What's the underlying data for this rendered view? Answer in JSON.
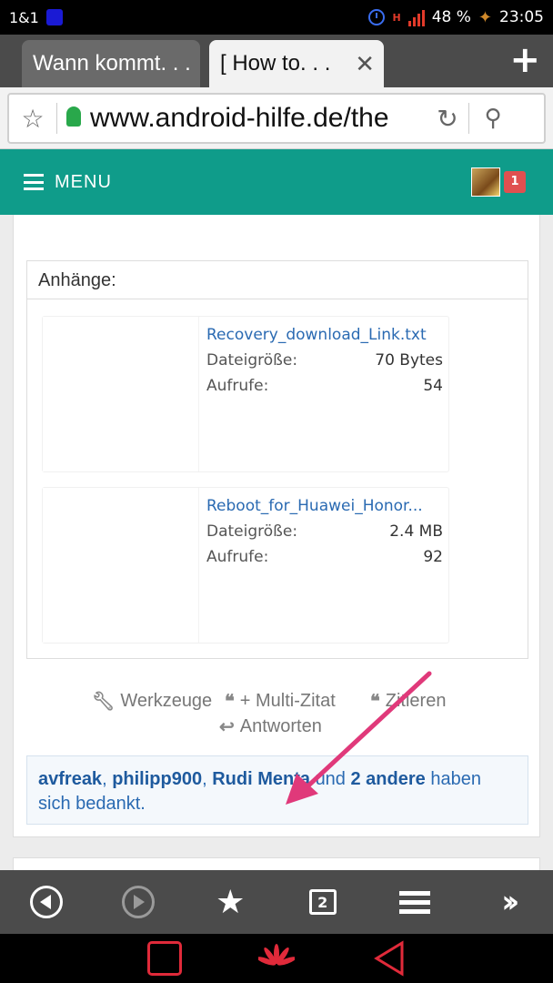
{
  "status_bar": {
    "carrier": "1&1",
    "battery": "48 %",
    "time": "23:05",
    "network_label": "H"
  },
  "tabs": [
    {
      "label": "Wann kommt. . ."
    },
    {
      "label": "[ How to. . ."
    }
  ],
  "address_bar": {
    "url": "www.android-hilfe.de/the"
  },
  "site_header": {
    "menu_label": "MENU",
    "notification_count": "1"
  },
  "attachments": {
    "title": "Anhänge:",
    "items": [
      {
        "name": "Recovery_download_Link.txt",
        "size_label": "Dateigröße:",
        "size": "70 Bytes",
        "views_label": "Aufrufe:",
        "views": "54"
      },
      {
        "name": "Reboot_for_Huawei_Honor...",
        "size_label": "Dateigröße:",
        "size": "2.4 MB",
        "views_label": "Aufrufe:",
        "views": "92"
      }
    ]
  },
  "post_actions": {
    "tools": "Werkzeuge",
    "multi_quote": "+ Multi-Zitat",
    "quote": "Zitieren",
    "reply": "Antworten"
  },
  "thanks": {
    "user1": "avfreak",
    "user2": "philipp900",
    "user3": "Rudi Menta",
    "and": "und",
    "others": "2 andere",
    "suffix": "haben sich bedankt."
  },
  "bottom_toolbar": {
    "tabs_count": "2"
  },
  "colors": {
    "header_teal": "#0f9c8a",
    "link_blue": "#2a6ab2",
    "annotation_arrow": "#e0397a",
    "badge_red": "#e05050"
  }
}
